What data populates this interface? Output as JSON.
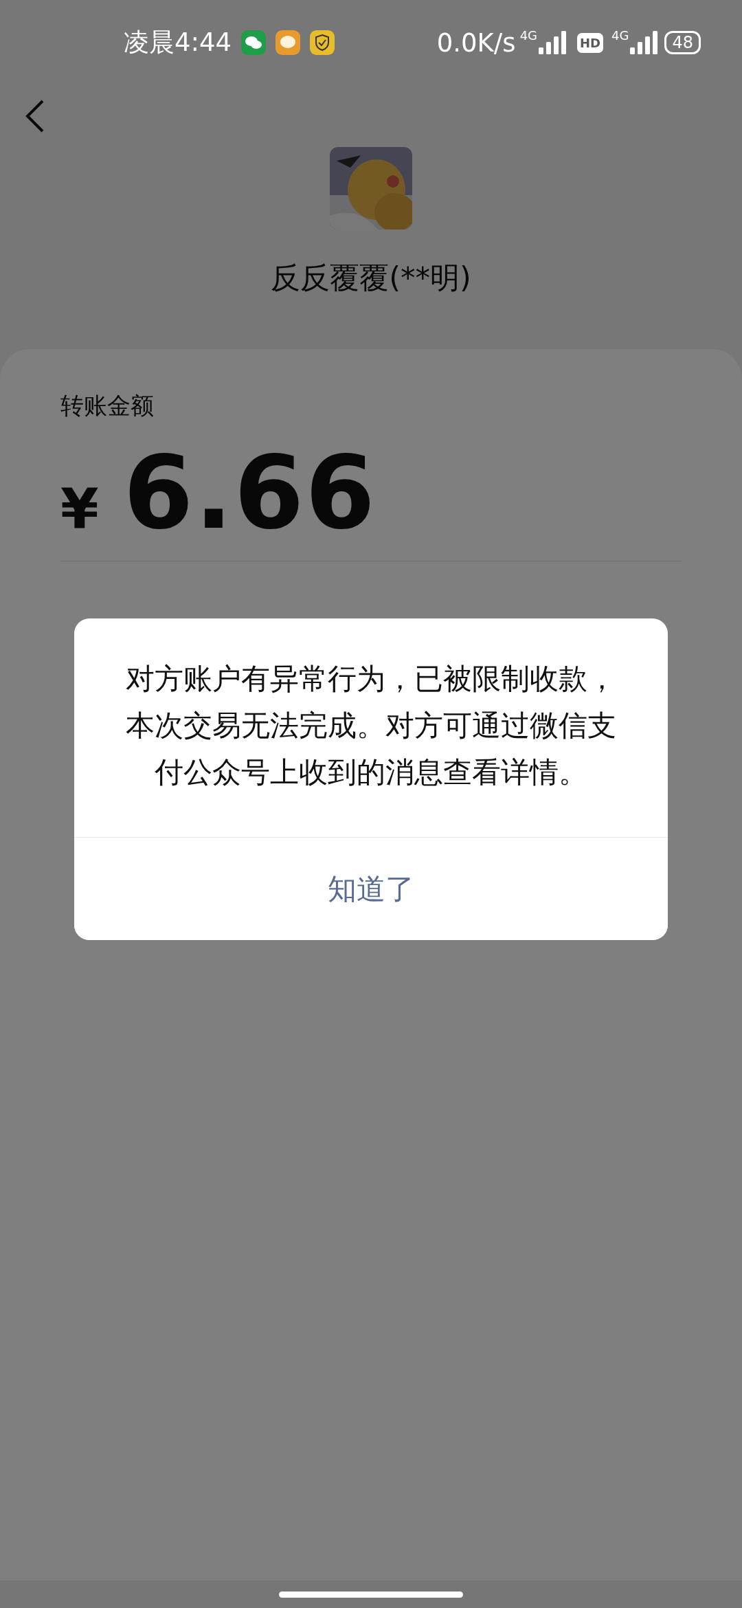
{
  "status_bar": {
    "time": "凌晨4:44",
    "network_speed": "0.0K/s",
    "signals": [
      {
        "label": "4G"
      },
      {
        "label": "4G"
      }
    ],
    "hd_badge": "HD",
    "battery": "48"
  },
  "header": {
    "name": "反反覆覆(**明)"
  },
  "transfer": {
    "label": "转账金额",
    "currency": "¥",
    "amount": "6.66"
  },
  "dialog": {
    "message": "对方账户有异常行为，已被限制收款，本次交易无法完成。对方可通过微信支付公众号上收到的消息查看详情。",
    "button": "知道了"
  }
}
